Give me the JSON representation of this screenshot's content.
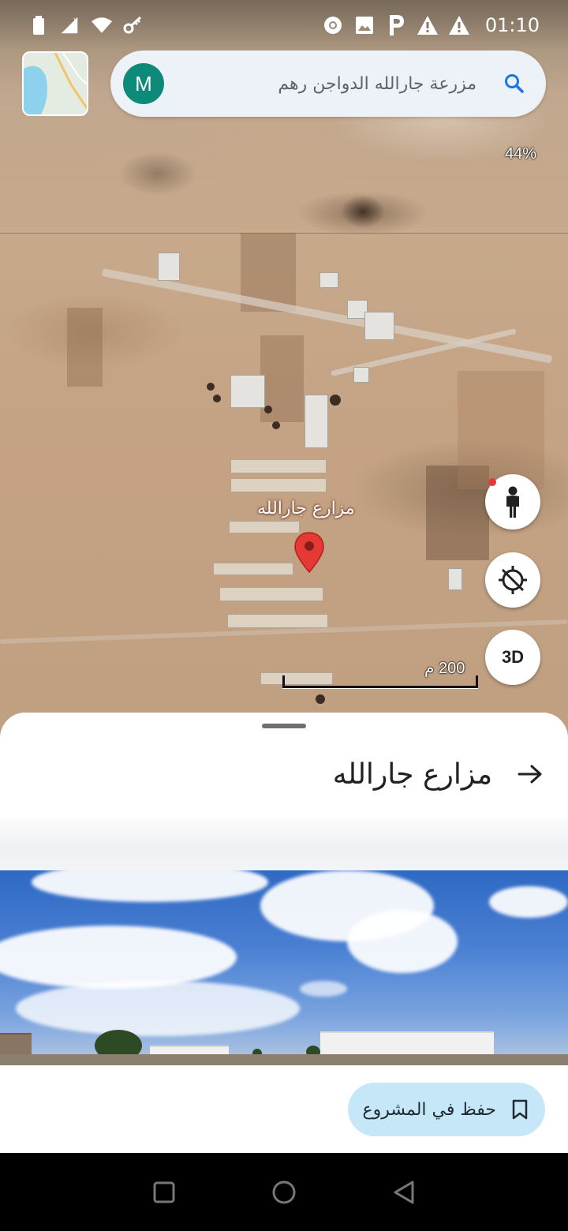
{
  "status_bar": {
    "time": "01:10",
    "icons_left": [
      "battery-icon",
      "no-signal-icon",
      "wifi-icon",
      "key-icon"
    ],
    "icons_right": [
      "chrome-icon",
      "image-icon",
      "parking-icon",
      "warning-icon",
      "warning-icon"
    ]
  },
  "search": {
    "avatar_letter": "M",
    "query": "مزرعة جارالله الدواجن رهم"
  },
  "map": {
    "zoom_label": "44%",
    "place_label": "مزارع جارالله",
    "scale_label": "200 م",
    "three_d_label": "3D",
    "marker_color": "#e53935"
  },
  "sheet": {
    "title": "مزارع جارالله",
    "save_label": "حفظ في المشروع"
  },
  "colors": {
    "avatar": "#0e8a7a",
    "search_bg": "#edf1f8",
    "save_chip": "#c5e7f8",
    "accent_blue": "#1a73e8"
  }
}
